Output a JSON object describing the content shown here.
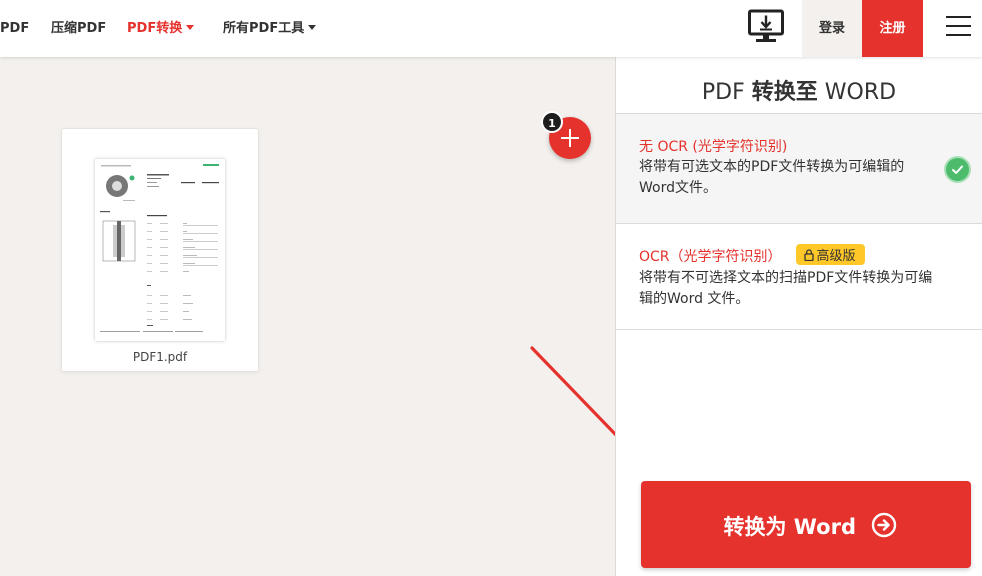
{
  "header": {
    "nav": [
      {
        "label": "PDF"
      },
      {
        "label": "压缩PDF"
      },
      {
        "label": "PDF转换"
      },
      {
        "label": "所有PDF工具"
      }
    ],
    "login_label": "登录",
    "signup_label": "注册"
  },
  "workspace": {
    "file_name": "PDF1.pdf",
    "file_count": "1"
  },
  "panel": {
    "title_prefix": "PDF ",
    "title_bold": "转换至",
    "title_suffix": " WORD",
    "options": [
      {
        "title": "无 OCR (光学字符识别)",
        "desc": "将带有可选文本的PDF文件转换为可编辑的Word文件。"
      },
      {
        "title": "OCR（光学字符识别）",
        "badge": "高级版",
        "desc": "将带有不可选择文本的扫描PDF文件转换为可编辑的Word 文件。"
      }
    ],
    "convert_label": "转换为 Word"
  },
  "colors": {
    "brand_red": "#e5322d",
    "check_green": "#4cbb6c",
    "premium_yellow": "#ffc727",
    "workspace_bg": "#f3f0ed"
  },
  "icons": [
    "desktop-download-icon",
    "hamburger-menu-icon",
    "plus-icon",
    "check-icon",
    "lock-icon",
    "arrow-right-circle-icon"
  ]
}
